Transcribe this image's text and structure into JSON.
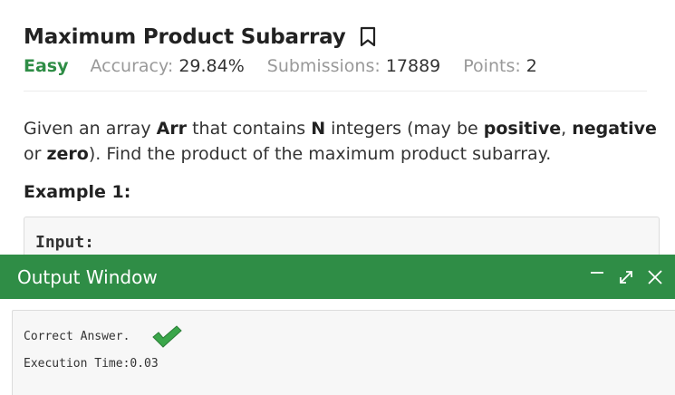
{
  "problem": {
    "title": "Maximum Product Subarray",
    "difficulty": "Easy",
    "accuracy_label": "Accuracy:",
    "accuracy_value": "29.84%",
    "submissions_label": "Submissions:",
    "submissions_value": "17889",
    "points_label": "Points:",
    "points_value": "2",
    "description": {
      "t1": "Given an array ",
      "b1": "Arr",
      "t2": " that contains ",
      "b2": "N",
      "t3": " integers (may be ",
      "b3": "positive",
      "t4": ", ",
      "b4": "negative",
      "t5": " or ",
      "b5": "zero",
      "t6": "). Find the product of the maximum product subarray."
    },
    "example_heading": "Example 1:",
    "example_input_label": "Input:"
  },
  "output_window": {
    "title": "Output Window",
    "line1": "Correct Answer.",
    "line2": "Execution Time:0.03"
  },
  "icons": {
    "bookmark": "bookmark-icon",
    "minimize": "minimize-icon",
    "expand": "expand-icon",
    "close": "close-icon",
    "check": "check-icon"
  },
  "colors": {
    "accent_green": "#2f8d46",
    "check_green": "#3aa64a"
  }
}
